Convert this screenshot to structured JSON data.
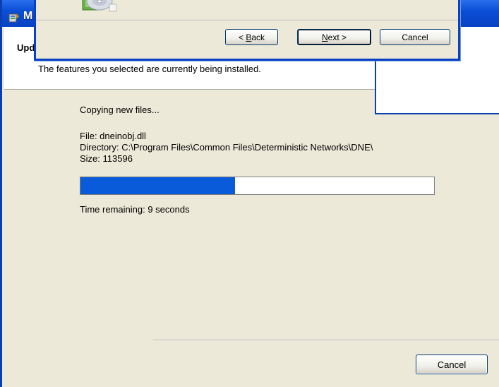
{
  "installer": {
    "title_fragment": "M",
    "header_title_fragment": "Upd",
    "header_subtitle": "The features you selected are currently being installed.",
    "status": "Copying new files...",
    "file_line": "File: dneinobj.dll",
    "directory_line": "Directory: C:\\Program Files\\Common Files\\Deterministic Networks\\DNE\\",
    "size_line": "Size: 113596",
    "progress_fraction": 0.438,
    "time_remaining": "Time remaining: 9 seconds",
    "cancel_label": "Cancel"
  },
  "front_dialog": {
    "back_label_pre": "< ",
    "back_label_mn": "B",
    "back_label_post": "ack",
    "next_label_mn": "N",
    "next_label_post": "ext >",
    "cancel_label": "Cancel"
  },
  "colors": {
    "titlebar_blue": "#0a4ed6",
    "progress_blue": "#0a5bd9",
    "dialog_bg": "#ece9d8"
  },
  "icons": {
    "app": "installer-app-icon",
    "media": "cd-disc-icon"
  }
}
